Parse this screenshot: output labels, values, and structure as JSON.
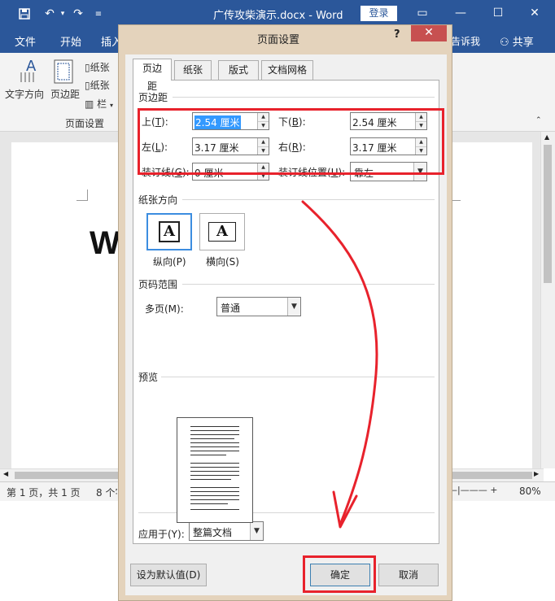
{
  "titlebar": {
    "doc_title": "广传攻柴演示.docx  -  Word",
    "login": "登录",
    "qa_save_icon": "save-icon",
    "qa_undo_icon": "undo-icon",
    "qa_redo_icon": "redo-icon"
  },
  "ribbon_tabs": [
    "文件",
    "开始",
    "插入"
  ],
  "ribbon_right": {
    "tell": "告诉我",
    "share": "共享"
  },
  "ribbon": {
    "text_direction": "文字方向",
    "margins": "页边距",
    "size1": "纸张",
    "size2": "纸张",
    "columns": "栏",
    "group_label": "页面设置"
  },
  "document": {
    "big_text": "W"
  },
  "statusbar": {
    "page_info": "第 1 页，共 1 页",
    "words": "8 个字",
    "zoom": "80%"
  },
  "dialog": {
    "title": "页面设置",
    "help": "?",
    "close": "✕",
    "tabs": [
      "页边距",
      "纸张",
      "版式",
      "文档网格"
    ],
    "margins_section": "页边距",
    "fields": {
      "top_label": "上(T):",
      "top_key": "T",
      "top_value": "2.54 厘米",
      "bottom_label": "下(B):",
      "bottom_key": "B",
      "bottom_value": "2.54 厘米",
      "left_label": "左(L):",
      "left_key": "L",
      "left_value": "3.17 厘米",
      "right_label": "右(R):",
      "right_key": "R",
      "right_value": "3.17 厘米",
      "gutter_label": "装订线(G):",
      "gutter_key": "G",
      "gutter_value": "0 厘米",
      "gutter_pos_label": "装订线位置(U):",
      "gutter_pos_key": "U",
      "gutter_pos_value": "靠左"
    },
    "orientation_section": "纸张方向",
    "portrait_glyph": "A",
    "landscape_glyph": "A",
    "portrait_label": "纵向(P)",
    "landscape_label": "横向(S)",
    "pages_section": "页码范围",
    "multi_pages_label": "多页(M):",
    "multi_pages_value": "普通",
    "preview_section": "预览",
    "apply_label": "应用于(Y):",
    "apply_value": "整篇文档",
    "default_button": "设为默认值(D)",
    "ok_button": "确定",
    "cancel_button": "取消"
  },
  "annotation_color": "#e8222c"
}
